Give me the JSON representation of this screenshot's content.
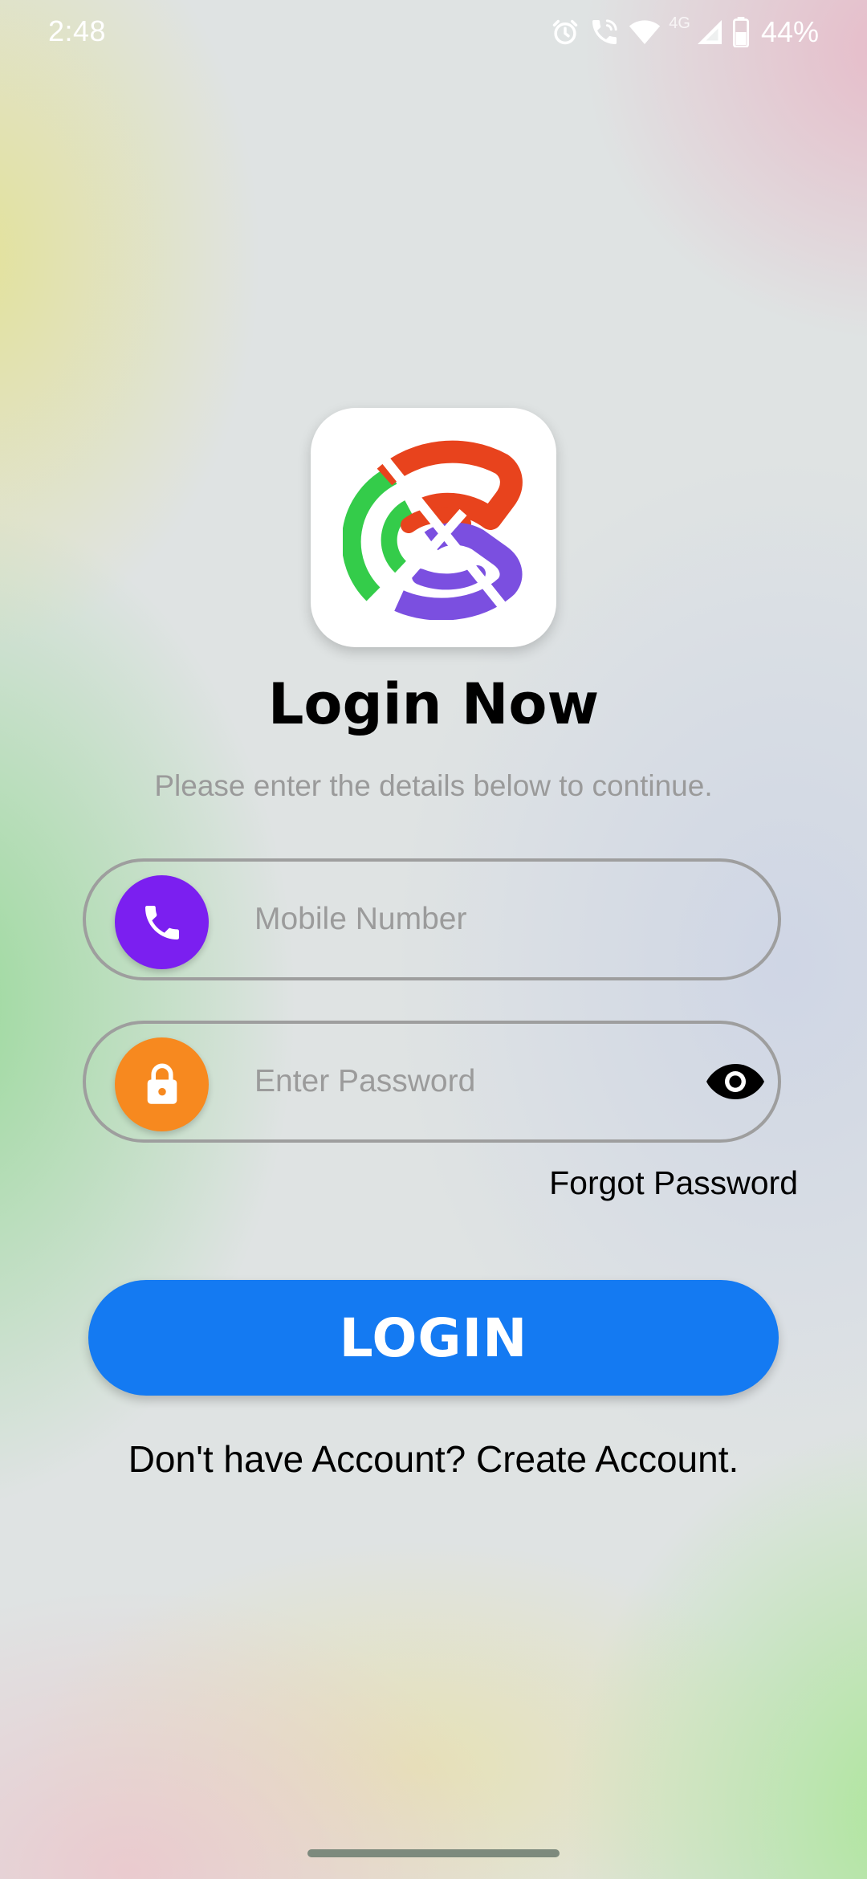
{
  "status_bar": {
    "time": "2:48",
    "network_label": "4G",
    "battery": "44%",
    "icons": [
      "alarm-icon",
      "wifi-calling-icon",
      "wifi-icon",
      "signal-icon",
      "battery-icon"
    ]
  },
  "logo": {
    "icon": "app-logo",
    "colors": {
      "red": "#e8431d",
      "green": "#34cc4a",
      "purple": "#7b4fe0"
    }
  },
  "login": {
    "title": "Login Now",
    "subtitle": "Please enter the details below to continue.",
    "mobile": {
      "placeholder": "Mobile Number",
      "value": "",
      "icon": "phone-icon",
      "icon_color": "#7b1ff0"
    },
    "password": {
      "placeholder": "Enter Password",
      "value": "",
      "icon": "lock-icon",
      "icon_color": "#f7891f",
      "toggle_icon": "eye-icon"
    },
    "forgot_label": "Forgot Password",
    "button_label": "LOGIN",
    "button_color": "#147af2",
    "signup_text": "Don't have Account? Create Account."
  }
}
